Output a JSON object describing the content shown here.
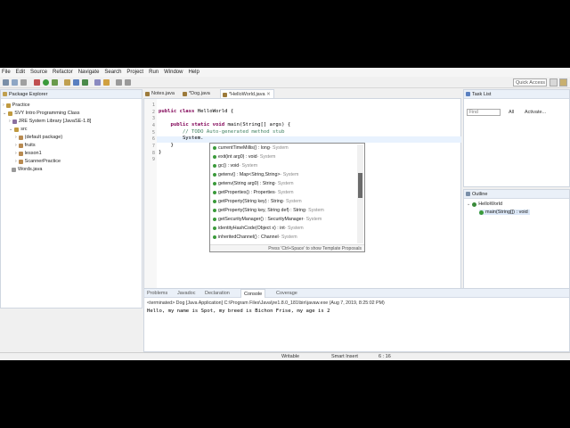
{
  "menu": [
    "File",
    "Edit",
    "Source",
    "Refactor",
    "Navigate",
    "Search",
    "Project",
    "Run",
    "Window",
    "Help"
  ],
  "quick_access": "Quick Access",
  "package_explorer": {
    "title": "Package Explorer",
    "items": [
      {
        "label": "Practice",
        "depth": 0
      },
      {
        "label": "SVY Intro Programming Class",
        "depth": 0
      },
      {
        "label": "JRE System Library [JavaSE-1.8]",
        "depth": 1
      },
      {
        "label": "src",
        "depth": 1
      },
      {
        "label": "(default package)",
        "depth": 2
      },
      {
        "label": "fruits",
        "depth": 2
      },
      {
        "label": "lesson1",
        "depth": 2
      },
      {
        "label": "ScannerPractice",
        "depth": 2
      },
      {
        "label": "Words.java",
        "depth": 1
      }
    ]
  },
  "editor": {
    "tabs": [
      "Notes.java",
      "*Dog.java",
      "*HelloWorld.java"
    ],
    "lines": [
      {
        "num": "1",
        "text": ""
      },
      {
        "num": "2",
        "text": "public class HelloWorld {"
      },
      {
        "num": "3",
        "text": ""
      },
      {
        "num": "4",
        "text": "    public static void main(String[] args) {"
      },
      {
        "num": "5",
        "text": "        // TODO Auto-generated method stub"
      },
      {
        "num": "6",
        "text": "        System."
      },
      {
        "num": "7",
        "text": "    }"
      },
      {
        "num": "8",
        "text": "}"
      },
      {
        "num": "9",
        "text": ""
      }
    ]
  },
  "content_assist": {
    "items": [
      {
        "name": "currentTimeMillis() : long",
        "type": " - System"
      },
      {
        "name": "exit(int arg0) : void",
        "type": " - System"
      },
      {
        "name": "gc() : void",
        "type": " - System"
      },
      {
        "name": "getenv() : Map<String,String>",
        "type": " - System"
      },
      {
        "name": "getenv(String arg0) : String",
        "type": " - System"
      },
      {
        "name": "getProperties() : Properties",
        "type": " - System"
      },
      {
        "name": "getProperty(String key) : String",
        "type": " - System"
      },
      {
        "name": "getProperty(String key, String def) : String",
        "type": " - System"
      },
      {
        "name": "getSecurityManager() : SecurityManager",
        "type": " - System"
      },
      {
        "name": "identityHashCode(Object x) : int",
        "type": " - System"
      },
      {
        "name": "inheritedChannel() : Channel",
        "type": " - System"
      }
    ],
    "footer": "Press 'Ctrl+Space' to show Template Proposals"
  },
  "task_list": {
    "title": "Task List",
    "find_placeholder": "Find",
    "all_label": "All",
    "activate_label": "Activate..."
  },
  "outline": {
    "title": "Outline",
    "class_name": "HelloWorld",
    "method": "main(String[]) : void"
  },
  "bottom_tabs": [
    "Problems",
    "Javadoc",
    "Declaration",
    "Console",
    "Coverage"
  ],
  "console": {
    "terminated": "<terminated> Dog [Java Application] C:\\Program Files\\Java\\jre1.8.0_181\\bin\\javaw.exe (Aug 7, 2019, 8:25:02 PM)",
    "output": "Hello, my name is Spot, my breed is Bichon Frise, my age is 2"
  },
  "status": {
    "writable": "Writable",
    "insert": "Smart Insert",
    "position": "6 : 16"
  },
  "colors": {
    "keyword": "#7f0055",
    "comment": "#3f7f5f",
    "panel_head": "#eaf0f8"
  }
}
